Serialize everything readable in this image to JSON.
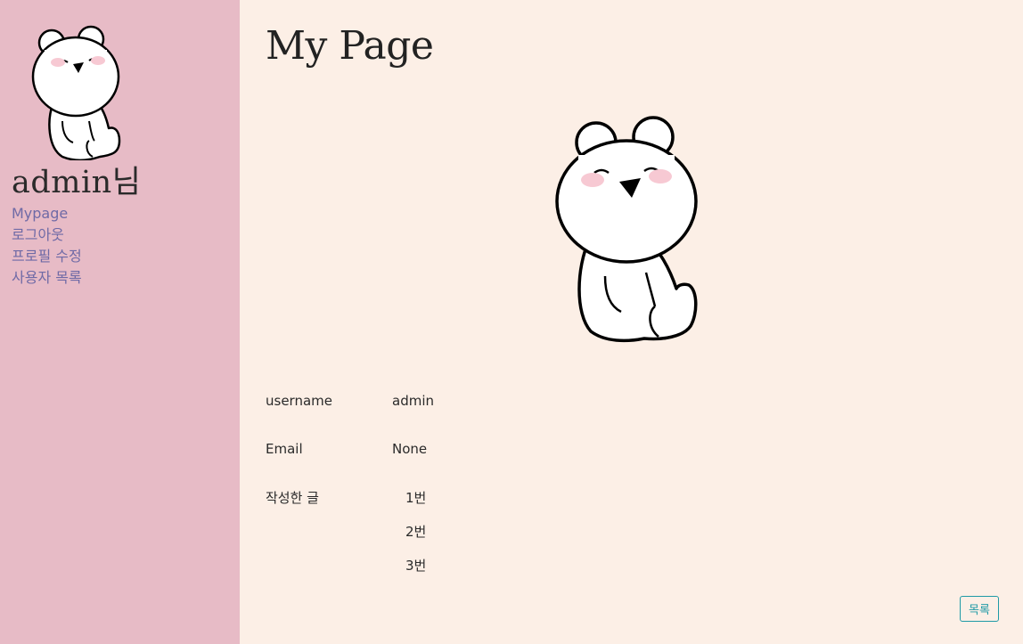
{
  "sidebar": {
    "username": "admin님",
    "avatar_icon": "bear-avatar-icon",
    "nav": [
      {
        "label": "Mypage"
      },
      {
        "label": "로그아웃"
      },
      {
        "label": "프로필 수정"
      },
      {
        "label": "사용자 목록"
      }
    ]
  },
  "main": {
    "title": "My Page",
    "avatar_icon": "bear-sitting-icon",
    "profile": {
      "username_label": "username",
      "username_value": "admin",
      "email_label": "Email",
      "email_value": "None",
      "posts_label": "작성한 글",
      "posts": [
        "1번",
        "2번",
        "3번"
      ]
    },
    "list_button": "목록"
  },
  "colors": {
    "sidebar_bg": "#e7bbc6",
    "main_bg": "#fcefe6",
    "nav_link": "#6f6aa6",
    "button_accent": "#1f9aa6"
  }
}
